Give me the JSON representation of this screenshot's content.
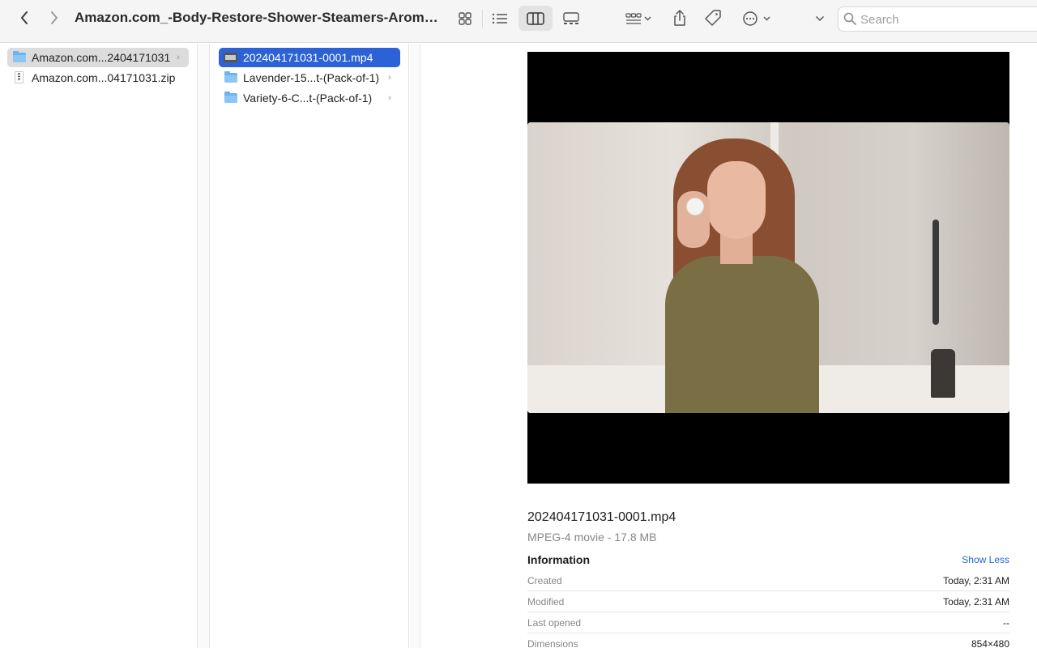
{
  "window": {
    "title": "Amazon.com_-Body-Restore-Shower-Steamers-Aromat...",
    "back_icon": "chevron-left-icon",
    "forward_icon": "chevron-right-icon"
  },
  "toolbar": {
    "views": [
      "icon-view-icon",
      "list-view-icon",
      "column-view-icon",
      "gallery-view-icon"
    ],
    "active_view": "column-view",
    "group_icon": "group-by-icon",
    "share_icon": "share-icon",
    "tag_icon": "tag-icon",
    "more_icon": "more-actions-icon"
  },
  "search": {
    "placeholder": "Search"
  },
  "columns": {
    "first": [
      {
        "label": "Amazon.com...2404171031",
        "type": "folder",
        "selected": true
      },
      {
        "label": "Amazon.com...04171031.zip",
        "type": "zip",
        "selected": false
      }
    ],
    "second": [
      {
        "label": "202404171031-0001.mp4",
        "type": "movie",
        "selected": true
      },
      {
        "label": "Lavender-15...t-(Pack-of-1)",
        "type": "folder",
        "selected": false
      },
      {
        "label": "Variety-6-C...t-(Pack-of-1)",
        "type": "folder",
        "selected": false
      }
    ]
  },
  "preview": {
    "filename": "202404171031-0001.mp4",
    "kind": "MPEG-4 movie - 17.8 MB",
    "info_heading": "Information",
    "show_less": "Show Less",
    "info": [
      {
        "key": "Created",
        "value": "Today, 2:31 AM"
      },
      {
        "key": "Modified",
        "value": "Today, 2:31 AM"
      },
      {
        "key": "Last opened",
        "value": "--"
      },
      {
        "key": "Dimensions",
        "value": "854×480"
      }
    ]
  },
  "colors": {
    "selection_blue": "#2c62d6",
    "link_blue": "#2165d8",
    "folder_blue": "#6cb3f2"
  }
}
